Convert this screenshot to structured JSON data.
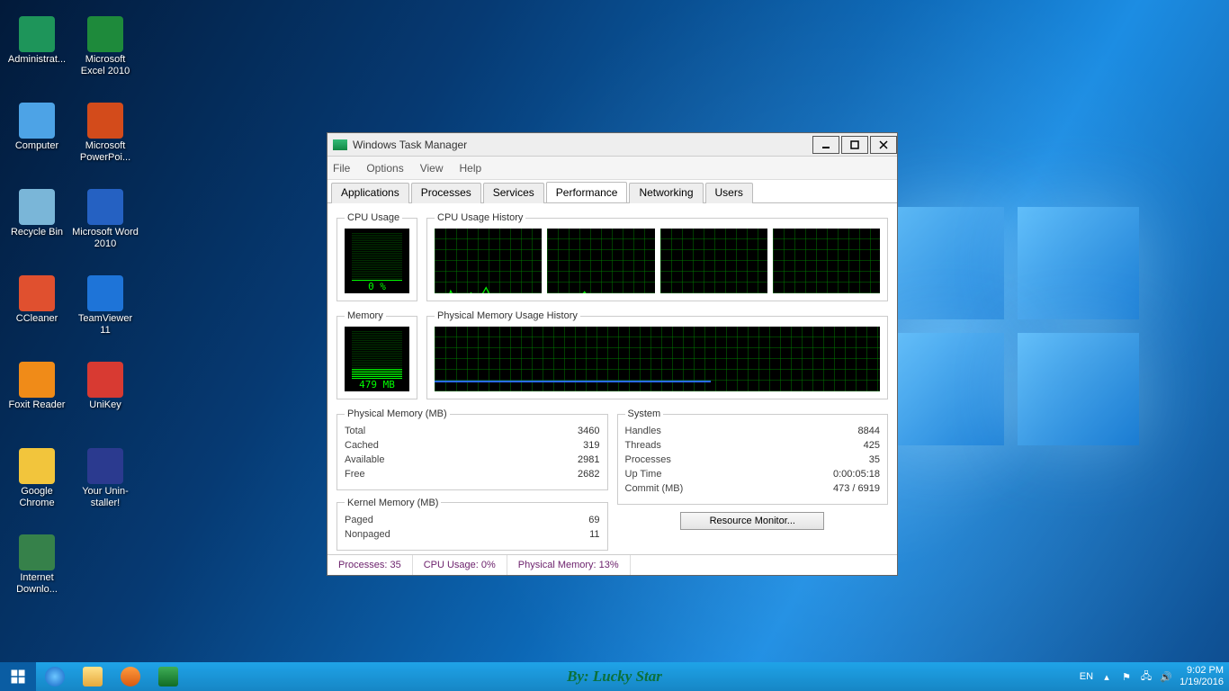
{
  "desktop_icons": [
    {
      "label": "Administrat...",
      "color": "#1e955a"
    },
    {
      "label": "Computer",
      "color": "#4da3e6"
    },
    {
      "label": "Recycle Bin",
      "color": "#7ab6d8"
    },
    {
      "label": "CCleaner",
      "color": "#e0502f"
    },
    {
      "label": "Foxit Reader",
      "color": "#f08b18"
    },
    {
      "label": "Google Chrome",
      "color": "#f2c53c"
    },
    {
      "label": "Internet Downlo...",
      "color": "#36814a"
    },
    {
      "label": "Microsoft Excel 2010",
      "color": "#1e8a3b"
    },
    {
      "label": "Microsoft PowerPoi...",
      "color": "#d34b1b"
    },
    {
      "label": "Microsoft Word 2010",
      "color": "#2561c2"
    },
    {
      "label": "TeamViewer 11",
      "color": "#1e74d8"
    },
    {
      "label": "UniKey",
      "color": "#d83a32"
    },
    {
      "label": "Your Unin-staller!",
      "color": "#2b3a8f"
    }
  ],
  "taskbar": {
    "center_text": "By: Lucky Star",
    "lang": "EN",
    "time": "9:02 PM",
    "date": "1/19/2016"
  },
  "window": {
    "title": "Windows Task Manager",
    "menu": [
      "File",
      "Options",
      "View",
      "Help"
    ],
    "tabs": [
      "Applications",
      "Processes",
      "Services",
      "Performance",
      "Networking",
      "Users"
    ],
    "active_tab": "Performance",
    "cpu_usage_label": "CPU Usage",
    "cpu_usage_value": "0 %",
    "cpu_history_label": "CPU Usage History",
    "memory_label": "Memory",
    "memory_value": "479 MB",
    "mem_history_label": "Physical Memory Usage History",
    "phys_mem": {
      "title": "Physical Memory (MB)",
      "Total": "3460",
      "Cached": "319",
      "Available": "2981",
      "Free": "2682"
    },
    "kernel_mem": {
      "title": "Kernel Memory (MB)",
      "Paged": "69",
      "Nonpaged": "11"
    },
    "system": {
      "title": "System",
      "Handles": "8844",
      "Threads": "425",
      "Processes": "35",
      "Up Time": "0:00:05:18",
      "Commit (MB)": "473 / 6919"
    },
    "resource_monitor": "Resource Monitor...",
    "status": {
      "processes": "Processes: 35",
      "cpu": "CPU Usage: 0%",
      "mem": "Physical Memory: 13%"
    }
  }
}
